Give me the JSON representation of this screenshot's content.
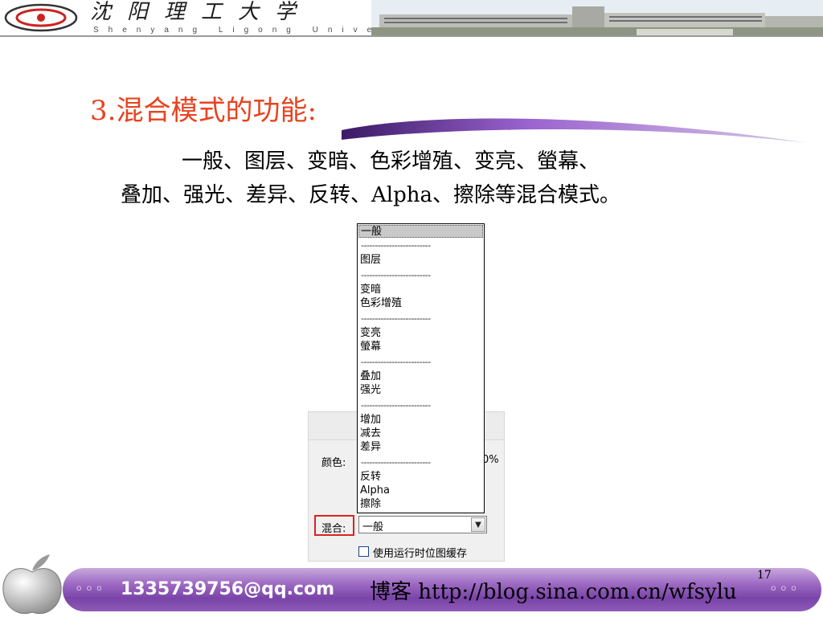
{
  "header": {
    "university_cn": "沈阳理工大学",
    "university_en": "Shenyang Ligong University"
  },
  "slide": {
    "title": "3.混合模式的功能:",
    "line1": "一般、图层、变暗、色彩增殖、变亮、螢幕、",
    "line2": "叠加、强光、差异、反转、Alpha、擦除等混合模式。",
    "page_number": "17"
  },
  "dropdown": {
    "items": [
      "一般",
      "图层",
      "变暗",
      "色彩增殖",
      "变亮",
      "螢幕",
      "叠加",
      "强光",
      "增加",
      "减去",
      "差异",
      "反转",
      "Alpha",
      "擦除"
    ],
    "separator": "-------------------------"
  },
  "panel": {
    "color_label": "颜色:",
    "percent_fragment": "0%",
    "blend_label": "混合:",
    "blend_value": "一般",
    "checkbox_label": "使用运行时位图缓存"
  },
  "footer": {
    "dots": "◦◦◦",
    "email": "1335739756@qq.com",
    "blog": "博客 http://blog.sina.com.cn/wfsylu"
  },
  "colors": {
    "title": "#e8431f",
    "footer_bar": "#8e5bb7",
    "highlight_box": "#e02020"
  }
}
